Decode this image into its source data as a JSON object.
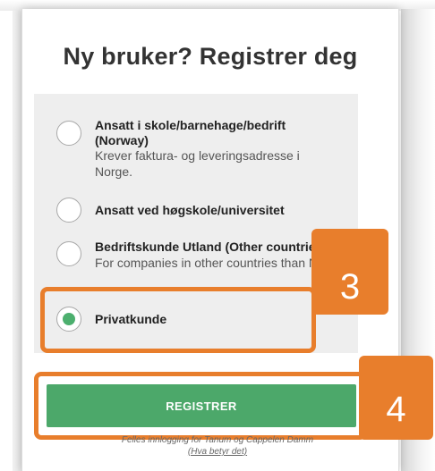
{
  "title": "Ny bruker? Registrer deg",
  "options": [
    {
      "title_line1": "Ansatt i skole/barnehage/bedrift",
      "title_line2": "(Norway)",
      "description": "Krever faktura- og leveringsadresse i Norge.",
      "checked": false
    },
    {
      "title_line1": "Ansatt ved høgskole/universitet",
      "checked": false
    },
    {
      "title_line1": "Bedriftskunde Utland (Other countries)",
      "description": "For companies in other countries than Norway.",
      "checked": false
    },
    {
      "title_line1": "Privatkunde",
      "checked": true
    }
  ],
  "register_button": "REGISTRER",
  "footer": {
    "text": "Felles innlogging for Tanum og Cappelen Damm",
    "link": "(Hva betyr det)"
  },
  "callouts": [
    "3",
    "4"
  ],
  "colors": {
    "accent_orange": "#e87e2c",
    "button_green": "#4ca86a",
    "radio_checked": "#4caf6e"
  }
}
